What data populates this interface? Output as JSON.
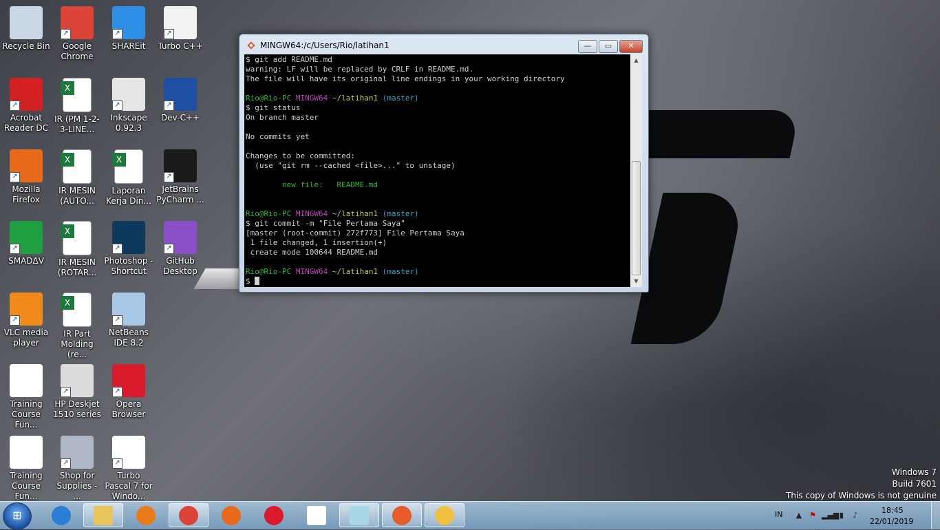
{
  "desktop_icons": [
    {
      "label": "Recycle Bin",
      "icon": "recycle-bin-icon",
      "color": "#c9d6e3",
      "shortcut": false
    },
    {
      "label": "Google Chrome",
      "icon": "chrome-icon",
      "color": "#db4437",
      "shortcut": true
    },
    {
      "label": "SHAREit",
      "icon": "shareit-icon",
      "color": "#2e8fe6",
      "shortcut": true
    },
    {
      "label": "Turbo C++",
      "icon": "turbo-cpp-icon",
      "color": "#f2f2f2",
      "shortcut": true
    },
    {
      "label": "Acrobat Reader DC",
      "icon": "acrobat-icon",
      "color": "#d32020",
      "shortcut": true
    },
    {
      "label": "IR (PM 1-2-3-LINE...",
      "icon": "excel-file-icon",
      "color": "#ffffff",
      "shortcut": false
    },
    {
      "label": "Inkscape 0.92.3",
      "icon": "inkscape-icon",
      "color": "#e5e5e5",
      "shortcut": true
    },
    {
      "label": "Dev-C++",
      "icon": "devcpp-icon",
      "color": "#1f4fa3",
      "shortcut": true
    },
    {
      "label": "Mozilla Firefox",
      "icon": "firefox-icon",
      "color": "#e66a1a",
      "shortcut": true
    },
    {
      "label": "IR MESIN (AUTO...",
      "icon": "excel-file-icon",
      "color": "#ffffff",
      "shortcut": false
    },
    {
      "label": "Laporan Kerja Din...",
      "icon": "excel-file-icon",
      "color": "#ffffff",
      "shortcut": false
    },
    {
      "label": "JetBrains PyCharm ...",
      "icon": "pycharm-icon",
      "color": "#1b1b1b",
      "shortcut": true
    },
    {
      "label": "SMADΔV",
      "icon": "smadav-icon",
      "color": "#1fa040",
      "shortcut": true
    },
    {
      "label": "IR MESIN (ROTAR...",
      "icon": "excel-file-icon",
      "color": "#ffffff",
      "shortcut": false
    },
    {
      "label": "Photoshop - Shortcut",
      "icon": "photoshop-icon",
      "color": "#0d3a5c",
      "shortcut": true
    },
    {
      "label": "GitHub Desktop",
      "icon": "github-icon",
      "color": "#8a4fc7",
      "shortcut": true
    },
    {
      "label": "VLC media player",
      "icon": "vlc-icon",
      "color": "#f08a1a",
      "shortcut": true
    },
    {
      "label": "IR Part Molding (re...",
      "icon": "excel-file-icon",
      "color": "#ffffff",
      "shortcut": false
    },
    {
      "label": "NetBeans IDE 8.2",
      "icon": "netbeans-icon",
      "color": "#a8c8e8",
      "shortcut": true
    },
    {
      "label": "",
      "icon": "",
      "color": "",
      "shortcut": false
    },
    {
      "label": "Training Course Fun...",
      "icon": "document-icon",
      "color": "#ffffff",
      "shortcut": false
    },
    {
      "label": "HP Deskjet 1510 series",
      "icon": "printer-icon",
      "color": "#dcdcdc",
      "shortcut": true
    },
    {
      "label": "Opera Browser",
      "icon": "opera-icon",
      "color": "#d91a2a",
      "shortcut": true
    },
    {
      "label": "",
      "icon": "",
      "color": "",
      "shortcut": false
    },
    {
      "label": "Training Course Fun...",
      "icon": "powerpoint-file-icon",
      "color": "#ffffff",
      "shortcut": false
    },
    {
      "label": "Shop for Supplies - ...",
      "icon": "printer-supplies-icon",
      "color": "#b0b8c8",
      "shortcut": true
    },
    {
      "label": "Turbo Pascal 7 for Windo...",
      "icon": "blank-file-icon",
      "color": "#ffffff",
      "shortcut": true
    }
  ],
  "window": {
    "title": "MINGW64:/c/Users/Rio/latihan1",
    "minimize": "—",
    "maximize": "▭",
    "close": "✕"
  },
  "terminal": {
    "lines": [
      [
        {
          "t": "$ git add README.md",
          "c": ""
        }
      ],
      [
        {
          "t": "warning: LF will be replaced by CRLF in README.md.",
          "c": ""
        }
      ],
      [
        {
          "t": "The file will have its original line endings in your working directory",
          "c": ""
        }
      ],
      [
        {
          "t": "",
          "c": ""
        }
      ],
      [
        {
          "t": "Rio@Rio-PC ",
          "c": "green"
        },
        {
          "t": "MINGW64 ",
          "c": "mag"
        },
        {
          "t": "~/latihan1 ",
          "c": "yel"
        },
        {
          "t": "(master)",
          "c": "cyan"
        }
      ],
      [
        {
          "t": "$ git status",
          "c": ""
        }
      ],
      [
        {
          "t": "On branch master",
          "c": ""
        }
      ],
      [
        {
          "t": "",
          "c": ""
        }
      ],
      [
        {
          "t": "No commits yet",
          "c": ""
        }
      ],
      [
        {
          "t": "",
          "c": ""
        }
      ],
      [
        {
          "t": "Changes to be committed:",
          "c": ""
        }
      ],
      [
        {
          "t": "  (use \"git rm --cached <file>...\" to unstage)",
          "c": ""
        }
      ],
      [
        {
          "t": "",
          "c": ""
        }
      ],
      [
        {
          "t": "        new file:   README.md",
          "c": "green"
        }
      ],
      [
        {
          "t": "",
          "c": ""
        }
      ],
      [
        {
          "t": "",
          "c": ""
        }
      ],
      [
        {
          "t": "Rio@Rio-PC ",
          "c": "green"
        },
        {
          "t": "MINGW64 ",
          "c": "mag"
        },
        {
          "t": "~/latihan1 ",
          "c": "yel"
        },
        {
          "t": "(master)",
          "c": "cyan"
        }
      ],
      [
        {
          "t": "$ git commit -m \"File Pertama Saya\"",
          "c": ""
        }
      ],
      [
        {
          "t": "[master (root-commit) 272f773] File Pertama Saya",
          "c": ""
        }
      ],
      [
        {
          "t": " 1 file changed, 1 insertion(+)",
          "c": ""
        }
      ],
      [
        {
          "t": " create mode 100644 README.md",
          "c": ""
        }
      ],
      [
        {
          "t": "",
          "c": ""
        }
      ],
      [
        {
          "t": "Rio@Rio-PC ",
          "c": "green"
        },
        {
          "t": "MINGW64 ",
          "c": "mag"
        },
        {
          "t": "~/latihan1 ",
          "c": "yel"
        },
        {
          "t": "(master)",
          "c": "cyan"
        }
      ],
      [
        {
          "t": "$ ",
          "c": "",
          "cursor": true
        }
      ]
    ]
  },
  "watermark": {
    "line1": "Windows 7",
    "line2": "Build 7601",
    "line3": "This copy of Windows is not genuine"
  },
  "taskbar": {
    "start_icon": "windows-start-icon",
    "apps": [
      {
        "name": "internet-explorer",
        "icon": "ie-icon",
        "color": "#2a7fd4",
        "active": false
      },
      {
        "name": "windows-explorer",
        "icon": "folder-icon",
        "color": "#e8c45a",
        "active": true
      },
      {
        "name": "media-player",
        "icon": "media-player-icon",
        "color": "#e87a1a",
        "active": false
      },
      {
        "name": "google-chrome",
        "icon": "chrome-icon",
        "color": "#db4437",
        "active": true
      },
      {
        "name": "firefox",
        "icon": "firefox-icon",
        "color": "#e66a1a",
        "active": false
      },
      {
        "name": "opera",
        "icon": "opera-icon",
        "color": "#d91a2a",
        "active": false
      },
      {
        "name": "calculator",
        "icon": "calculator-icon",
        "color": "#ffffff",
        "active": false
      },
      {
        "name": "notepad",
        "icon": "notepad-icon",
        "color": "#a8d8e8",
        "active": true
      },
      {
        "name": "git-bash",
        "icon": "git-bash-icon",
        "color": "#e85a2a",
        "active": true
      },
      {
        "name": "paint",
        "icon": "paint-icon",
        "color": "#f0c040",
        "active": true
      }
    ],
    "language": "IN",
    "time": "18:45",
    "date": "22/01/2019"
  }
}
